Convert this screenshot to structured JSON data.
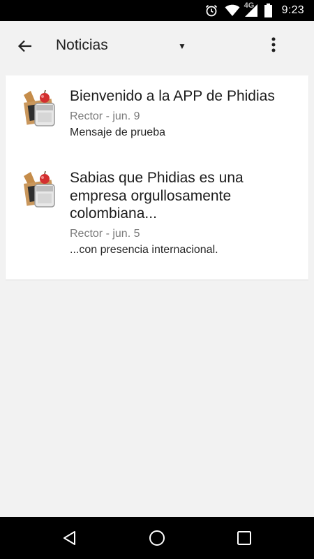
{
  "status_bar": {
    "time": "9:23",
    "network": "4G",
    "icons": [
      "alarm-icon",
      "wifi-icon",
      "cellular-icon",
      "battery-icon"
    ]
  },
  "app_bar": {
    "title": "Noticias",
    "back_icon": "arrow-left-icon",
    "spinner_icon": "dropdown-triangle-icon",
    "overflow_icon": "more-vert-icon"
  },
  "messages": [
    {
      "title": "Bienvenido a la APP de Phidias",
      "author": "Rector",
      "date": "jun. 9",
      "body": "Mensaje de prueba"
    },
    {
      "title": "Sabias que Phidias es una empresa orgullosamente colombiana...",
      "author": "Rector",
      "date": "jun. 5",
      "body": "...con presencia internacional."
    }
  ],
  "nav_bar": {
    "icons": [
      "nav-back-icon",
      "nav-home-icon",
      "nav-recents-icon"
    ]
  },
  "colors": {
    "status_bar_bg": "#000000",
    "app_bg": "#f2f2f2",
    "card_bg": "#ffffff",
    "meta_text": "#7a7a7a"
  }
}
